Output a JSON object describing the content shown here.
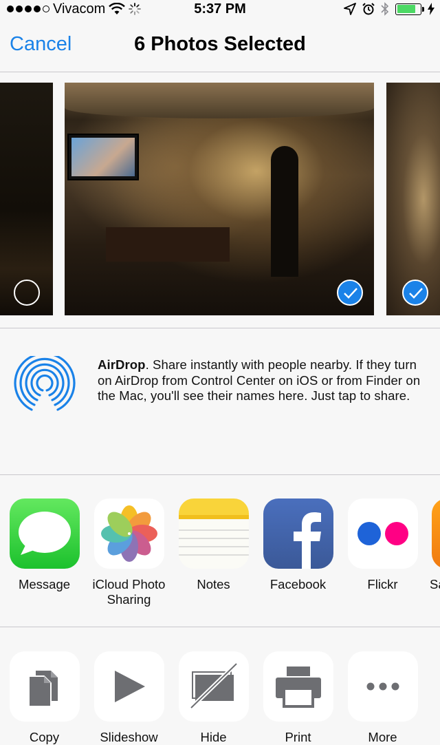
{
  "status_bar": {
    "carrier": "Vivacom",
    "time": "5:37 PM",
    "battery_level": 0.8
  },
  "nav": {
    "cancel_label": "Cancel",
    "title": "6 Photos Selected"
  },
  "photos": [
    {
      "selected": false
    },
    {
      "selected": true
    },
    {
      "selected": true
    }
  ],
  "airdrop": {
    "title": "AirDrop",
    "description": ". Share instantly with people nearby. If they turn on AirDrop from Control Center on iOS or from Finder on the Mac, you'll see their names here. Just tap to share."
  },
  "apps": [
    {
      "label": "Message",
      "icon": "messages-icon"
    },
    {
      "label": "iCloud Photo Sharing",
      "icon": "photos-icon"
    },
    {
      "label": "Notes",
      "icon": "notes-icon"
    },
    {
      "label": "Facebook",
      "icon": "facebook-icon"
    },
    {
      "label": "Flickr",
      "icon": "flickr-icon"
    },
    {
      "label": "Sa",
      "icon": "partial-app-icon"
    }
  ],
  "actions": [
    {
      "label": "Copy",
      "icon": "copy-icon"
    },
    {
      "label": "Slideshow",
      "icon": "slideshow-icon"
    },
    {
      "label": "Hide",
      "icon": "hide-icon"
    },
    {
      "label": "Print",
      "icon": "print-icon"
    },
    {
      "label": "More",
      "icon": "more-icon"
    }
  ],
  "colors": {
    "accent": "#1a82e8",
    "background": "#f7f7f7",
    "separator": "#c8c7cc"
  }
}
